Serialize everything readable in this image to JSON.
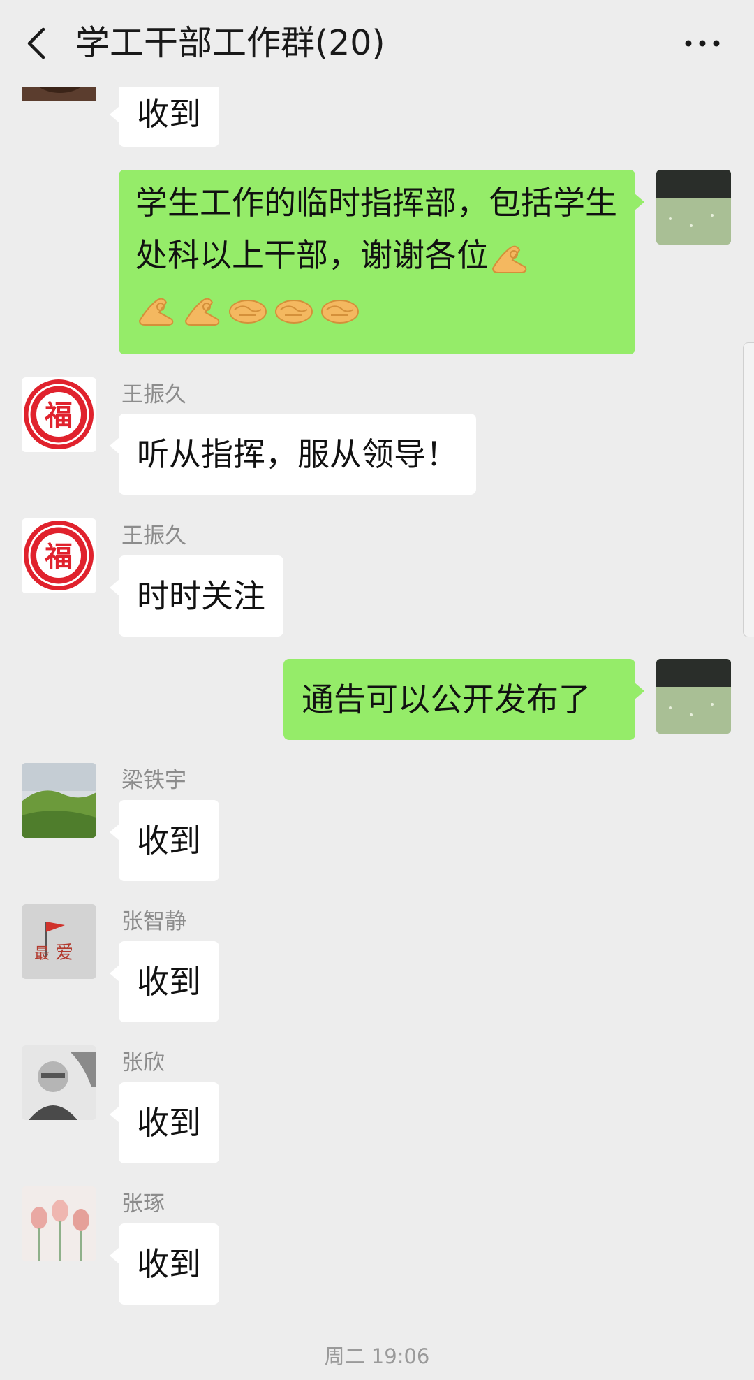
{
  "header": {
    "title": "学工干部工作群(20)"
  },
  "messages": [
    {
      "sender": "",
      "text": "收到",
      "direction": "in"
    },
    {
      "sender": "",
      "text": "学生工作的临时指挥部，包括学生处科以上干部，谢谢各位",
      "direction": "out",
      "emojis": [
        "ok-hand-emoji",
        "ok-hand-emoji",
        "ok-hand-emoji",
        "handshake-emoji",
        "handshake-emoji",
        "handshake-emoji"
      ]
    },
    {
      "sender": "王振久",
      "text": "听从指挥，服从领导！",
      "direction": "in"
    },
    {
      "sender": "王振久",
      "text": "时时关注",
      "direction": "in"
    },
    {
      "sender": "",
      "text": "通告可以公开发布了",
      "direction": "out"
    },
    {
      "sender": "梁铁宇",
      "text": "收到",
      "direction": "in"
    },
    {
      "sender": "张智静",
      "text": "收到",
      "direction": "in"
    },
    {
      "sender": "张欣",
      "text": "收到",
      "direction": "in"
    },
    {
      "sender": "张琢",
      "text": "收到",
      "direction": "in"
    }
  ],
  "timestamp": "周二 19:06",
  "colors": {
    "background": "#ededed",
    "outgoing_bubble": "#95ec69",
    "incoming_bubble": "#ffffff"
  }
}
